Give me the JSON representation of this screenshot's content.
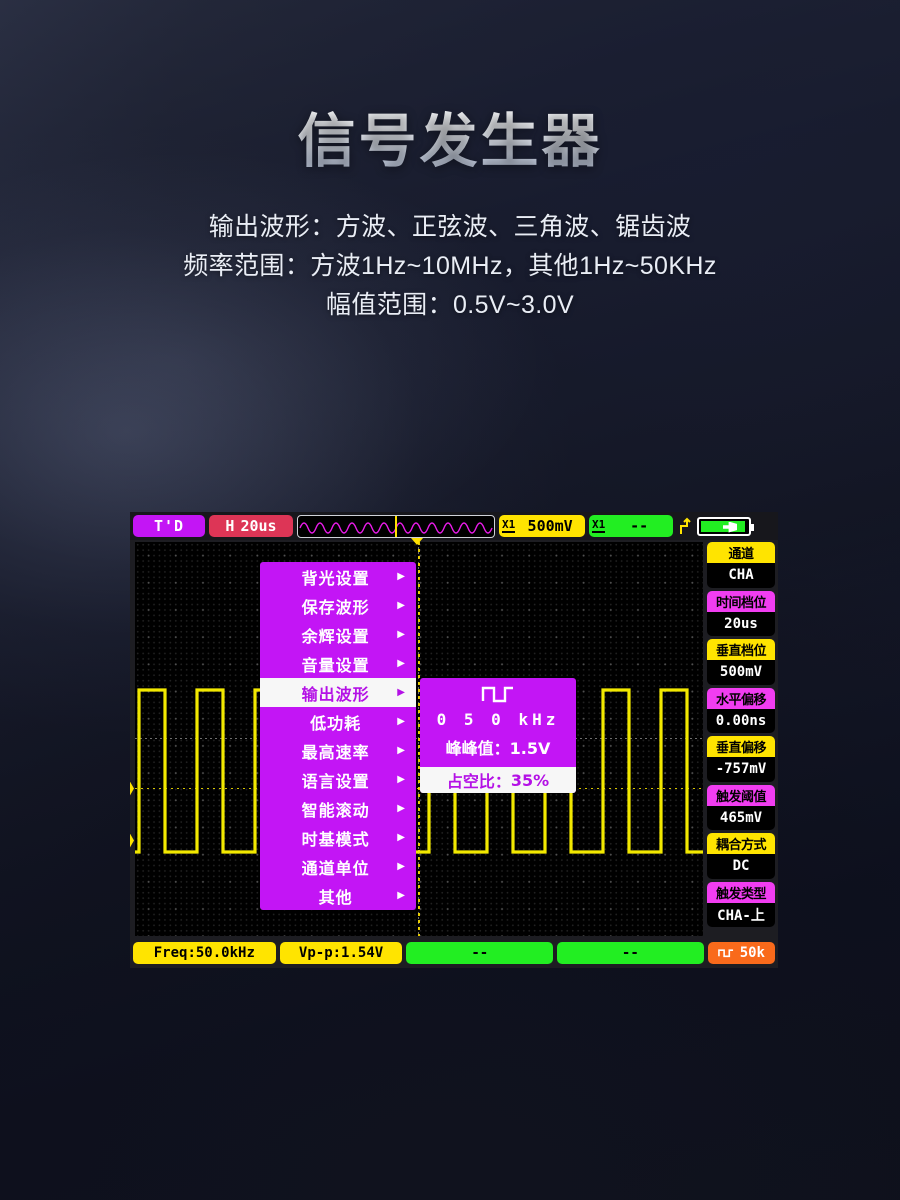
{
  "promo": {
    "title": "信号发生器",
    "lines": [
      "输出波形：方波、正弦波、三角波、锯齿波",
      "频率范围：方波1Hz~10MHz，其他1Hz~50KHz",
      "幅值范围：0.5V~3.0V"
    ]
  },
  "topbar": {
    "run_state": "T'D",
    "timebase_key": "H",
    "timebase_value": "20us",
    "ch1_scale_value": "500mV",
    "ch2_scale_value": "--",
    "probe_label": "X1",
    "trigger_edge_icon": "rising-edge-icon",
    "battery_icon": "battery-charging-icon"
  },
  "edge_markers": {
    "trigger": "T",
    "channel": "A"
  },
  "menu": {
    "items": [
      {
        "label": "背光设置",
        "arrow": "▶",
        "selected": false
      },
      {
        "label": "保存波形",
        "arrow": "▶",
        "selected": false
      },
      {
        "label": "余辉设置",
        "arrow": "▶",
        "selected": false
      },
      {
        "label": "音量设置",
        "arrow": "▶",
        "selected": false
      },
      {
        "label": "输出波形",
        "arrow": "▶",
        "selected": true
      },
      {
        "label": "低功耗",
        "arrow": "▶",
        "selected": false
      },
      {
        "label": "最高速率",
        "arrow": "▶",
        "selected": false
      },
      {
        "label": "语言设置",
        "arrow": "▶",
        "selected": false
      },
      {
        "label": "智能滚动",
        "arrow": "▶",
        "selected": false
      },
      {
        "label": "时基模式",
        "arrow": "▶",
        "selected": false
      },
      {
        "label": "通道单位",
        "arrow": "▶",
        "selected": false
      },
      {
        "label": "其他",
        "arrow": "▶",
        "selected": false
      }
    ]
  },
  "submenu": {
    "wave_icon": "square-wave-icon",
    "frequency": "0 5 0 kHz",
    "amplitude_label": "峰峰值：",
    "amplitude_value": "1.5V",
    "duty_label": "占空比：",
    "duty_value": "35%"
  },
  "sidebar": {
    "blocks": [
      {
        "header": "通道",
        "value": "CHA",
        "color": "yellow"
      },
      {
        "header": "时间档位",
        "value": "20us",
        "color": "magenta"
      },
      {
        "header": "垂直档位",
        "value": "500mV",
        "color": "yellow"
      },
      {
        "header": "水平偏移",
        "value": "0.00ns",
        "color": "magenta"
      },
      {
        "header": "垂直偏移",
        "value": "-757mV",
        "color": "yellow"
      },
      {
        "header": "触发阈值",
        "value": "465mV",
        "color": "magenta"
      },
      {
        "header": "耦合方式",
        "value": "DC",
        "color": "yellow"
      },
      {
        "header": "触发类型",
        "value": "CHA-上",
        "color": "magenta"
      }
    ]
  },
  "bottombar": {
    "freq": "Freq:50.0kHz",
    "vpp": "Vp-p:1.54V",
    "meas3": "--",
    "meas4": "--",
    "gen_icon": "square-wave-icon",
    "gen_value": "50k"
  },
  "colors": {
    "purple": "#c315f5",
    "yellow": "#ffe400",
    "magenta": "#f13df1",
    "green": "#22ee22",
    "orange": "#f96a1b",
    "red": "#dd3556",
    "trace": "#f2e800"
  }
}
